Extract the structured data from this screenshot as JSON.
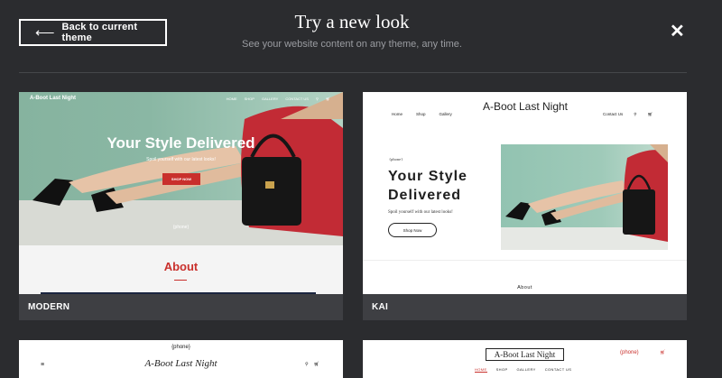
{
  "header": {
    "back_label": "Back to current theme",
    "back_icon": "arrow-left-icon",
    "title": "Try a new look",
    "subtitle": "See your website content on any theme, any time.",
    "close_icon": "close-icon"
  },
  "themes": [
    {
      "name": "MODERN",
      "preview": {
        "brand": "A-Boot Last Night",
        "nav": [
          "HOME",
          "SHOP",
          "GALLERY",
          "CONTACT US"
        ],
        "headline": "Your Style Delivered",
        "tagline": "Spoil yourself with our latest looks!",
        "button": "SHOP NOW",
        "phone": "{phone}",
        "section": "About",
        "accent": "#c9302c"
      }
    },
    {
      "name": "KAI",
      "preview": {
        "brand": "A-Boot Last Night",
        "nav_left": [
          "Home",
          "Shop",
          "Gallery"
        ],
        "nav_right": "Contact Us",
        "phone": "{phone}",
        "headline": "Your Style Delivered",
        "tagline": "Spoil yourself with our latest looks!",
        "button": "Shop Now",
        "section": "About"
      }
    },
    {
      "preview": {
        "phone": "{phone}",
        "brand": "A-Boot Last Night"
      }
    },
    {
      "preview": {
        "brand": "A-Boot Last Night",
        "phone": "(phone)",
        "nav": [
          "HOME",
          "SHOP",
          "GALLERY",
          "CONTACT US"
        ]
      }
    }
  ]
}
